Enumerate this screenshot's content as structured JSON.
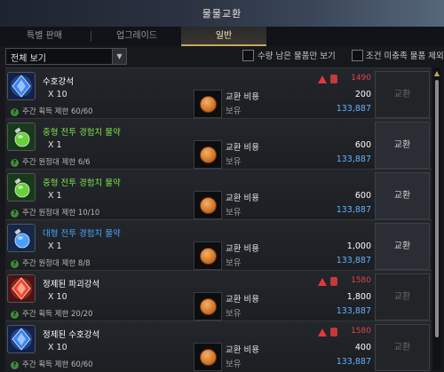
{
  "window": {
    "title": "물물교환"
  },
  "tabs": [
    {
      "label": "특별 판매",
      "active": false
    },
    {
      "label": "업그레이드",
      "active": false
    },
    {
      "label": "일반",
      "active": true
    }
  ],
  "filter": {
    "selected": "전체 보기",
    "checkbox1_label": "수량 남은 물품만 보기",
    "checkbox2_label": "조건 미충족 물품 제외"
  },
  "common": {
    "cost_label": "교환 비용",
    "own_label": "보유",
    "exchange_label": "교환"
  },
  "items": [
    {
      "name": "수호강석",
      "name_color": "#ffffff",
      "qty": "X 10",
      "limit": "주간 획득 제한 60/60",
      "special_cost": "1490",
      "cost": "200",
      "owned": "133,887",
      "icon": "blue-crystal-icon",
      "enabled": false
    },
    {
      "name": "중형 전투 경험치 물약",
      "name_color": "#7ee34f",
      "qty": "X 1",
      "limit": "주간 원정대 제한 6/6",
      "special_cost": "",
      "cost": "600",
      "owned": "133,887",
      "icon": "green-potion-icon",
      "enabled": true
    },
    {
      "name": "중형 전투 경험치 물약",
      "name_color": "#7ee34f",
      "qty": "X 1",
      "limit": "주간 원정대 제한 10/10",
      "special_cost": "",
      "cost": "600",
      "owned": "133,887",
      "icon": "green-potion-icon",
      "enabled": true
    },
    {
      "name": "대형 전투 경험치 물약",
      "name_color": "#4aa6ff",
      "qty": "X 1",
      "limit": "주간 원정대 제한 8/8",
      "special_cost": "",
      "cost": "1,000",
      "owned": "133,887",
      "icon": "blue-potion-icon",
      "enabled": true
    },
    {
      "name": "정제된 파괴강석",
      "name_color": "#ffffff",
      "qty": "X 10",
      "limit": "주간 획득 제한 20/20",
      "special_cost": "1580",
      "cost": "1,800",
      "owned": "133,887",
      "icon": "red-crystal-icon",
      "enabled": false
    },
    {
      "name": "정제된 수호강석",
      "name_color": "#ffffff",
      "qty": "X 10",
      "limit": "주간 획득 제한 60/60",
      "special_cost": "1580",
      "cost": "400",
      "owned": "133,887",
      "icon": "blue-crystal-icon",
      "enabled": false
    }
  ],
  "colors": {
    "accent": "#c9a55d",
    "owned": "#5fb3ff",
    "special": "#e04444"
  }
}
